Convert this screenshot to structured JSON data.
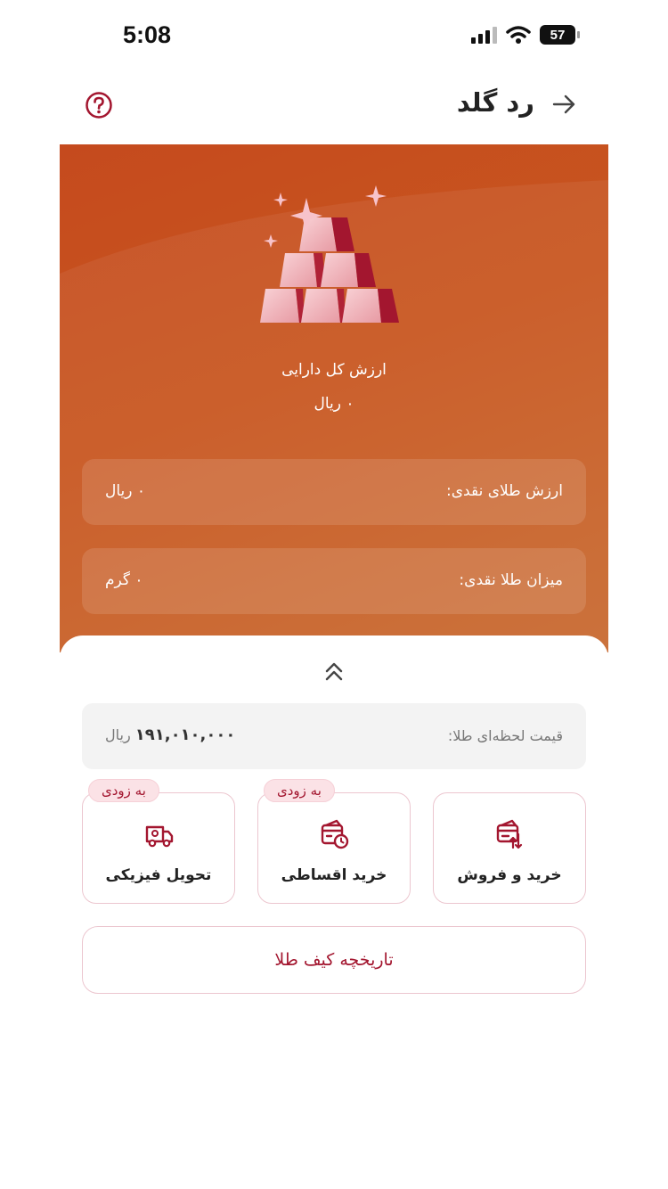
{
  "status_bar": {
    "time": "5:08",
    "battery": "57"
  },
  "header": {
    "title": "رد گلد"
  },
  "summary": {
    "total_label": "ارزش کل دارایی",
    "total_value": "۰ ریال",
    "cards": [
      {
        "label": "ارزش طلای نقدی:",
        "value": "۰ ریال"
      },
      {
        "label": "میزان طلا نقدی:",
        "value": "۰ گرم"
      }
    ]
  },
  "price": {
    "label": "قیمت لحظه‌ای طلا:",
    "value": "۱۹۱,۰۱۰,۰۰۰",
    "unit": "ریال"
  },
  "actions": [
    {
      "label": "خرید و فروش",
      "badge": ""
    },
    {
      "label": "خرید اقساطی",
      "badge": "به زودی"
    },
    {
      "label": "تحویل فیزیکی",
      "badge": "به زودی"
    }
  ],
  "history_button": "تاریخچه کیف طلا",
  "colors": {
    "accent": "#a3162f",
    "hero": "#c54a1e",
    "border": "#ecc6cf"
  }
}
